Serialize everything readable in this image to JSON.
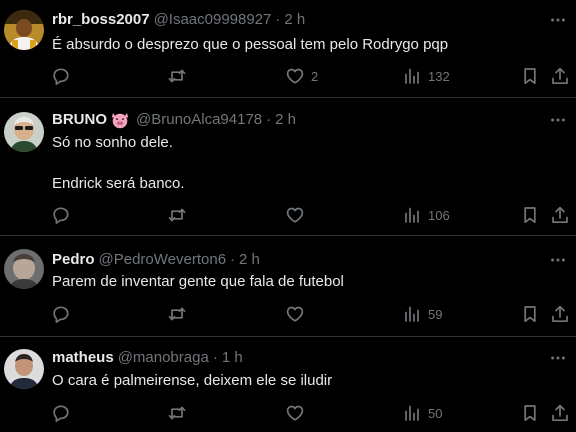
{
  "tweets": [
    {
      "name": "rbr_boss2007",
      "handle": "@Isaac09998927",
      "separator": "·",
      "time": "2 h",
      "lines": [
        "É absurdo o desprezo que o pessoal tem pelo Rodrygo pqp"
      ],
      "likes": "2",
      "views": "132"
    },
    {
      "name": "BRUNO",
      "name_emoji": "pig-face-icon",
      "handle": "@BrunoAlca94178",
      "separator": "·",
      "time": "2 h",
      "lines": [
        "Só no sonho dele.",
        "Endrick será banco."
      ],
      "likes": "",
      "views": "106"
    },
    {
      "name": "Pedro",
      "handle": "@PedroWeverton6",
      "separator": "·",
      "time": "2 h",
      "lines": [
        "Parem de inventar gente que fala de futebol"
      ],
      "likes": "",
      "views": "59"
    },
    {
      "name": "matheus",
      "handle": "@manobraga",
      "separator": "·",
      "time": "1 h",
      "lines": [
        "O cara é palmeirense, deixem ele se iludir"
      ],
      "likes": "",
      "views": "50"
    }
  ],
  "icons": [
    "reply-icon",
    "retweet-icon",
    "like-icon",
    "views-icon",
    "bookmark-icon",
    "share-icon",
    "more-icon"
  ],
  "colors": {
    "background": "#000000",
    "text": "#e7e9ea",
    "muted": "#71767b",
    "divider": "#2f3336"
  }
}
